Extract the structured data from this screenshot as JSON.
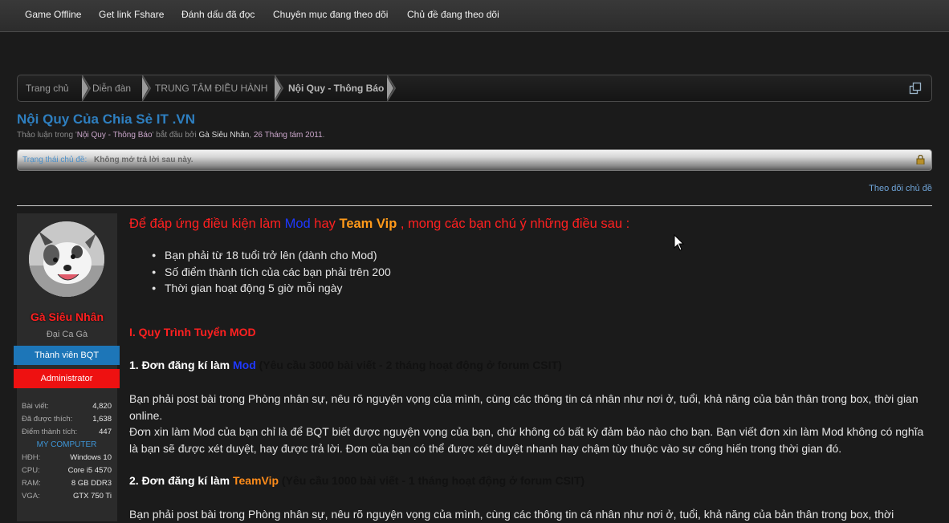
{
  "nav": {
    "items": [
      "Game Offline",
      "Get link Fshare",
      "Đánh dấu đã đọc",
      "Chuyên mục đang theo dõi",
      "Chủ đề đang theo dõi"
    ]
  },
  "breadcrumb": {
    "items": [
      "Trang chủ",
      "Diễn đàn",
      "TRUNG TÂM ĐIỀU HÀNH",
      "Nội Quy - Thông Báo"
    ]
  },
  "thread": {
    "title": "Nội Quy Của Chia Sẻ IT .VN",
    "meta_prefix": "Thảo luận trong '",
    "forum": "Nội Quy - Thông Báo",
    "meta_mid": "' bắt đầu bởi ",
    "author": "Gà Siêu Nhân",
    "date": "26 Tháng tám 2011",
    "status_label": "Trạng thái chủ đề:",
    "status_value": "Không mở trả lời sau này.",
    "follow": "Theo dõi chủ đề"
  },
  "user": {
    "name": "Gà Siêu Nhân",
    "title": "Đại Ca Gà",
    "badge1": "Thành viên BQT",
    "badge2": "Administrator",
    "stats": [
      {
        "k": "Bài viết:",
        "v": "4,820"
      },
      {
        "k": "Đã được thích:",
        "v": "1,638"
      },
      {
        "k": "Điểm thành tích:",
        "v": "447"
      }
    ],
    "mycomputer": "MY COMPUTER",
    "specs": [
      {
        "k": "HĐH:",
        "v": "Windows 10"
      },
      {
        "k": "CPU:",
        "v": "Core i5 4570"
      },
      {
        "k": "RAM:",
        "v": "8 GB DDR3"
      },
      {
        "k": "VGA:",
        "v": "GTX 750 Ti"
      }
    ]
  },
  "post": {
    "headline_a": "Để đáp ứng điều kiện làm ",
    "headline_mod": "Mod",
    "headline_b": " hay ",
    "headline_vip": "Team Vip",
    "headline_c": " , mong các bạn chú ý những điều sau :",
    "bullets": [
      "Bạn phải từ 18 tuổi trở lên (dành cho Mod)",
      "Số điểm thành tích của các bạn phải trên 200",
      "Thời gian hoạt động 5 giờ mỗi ngày"
    ],
    "section1": "I. Quy Trình Tuyển MOD",
    "step1_a": "1. Đơn đăng kí làm ",
    "step1_role": "Mod",
    "step1_req": " (Yêu cầu 3000 bài viết - 2 tháng hoạt động ở forum CSIT)",
    "para1": "Bạn phải post bài trong Phòng nhân sự, nêu rõ nguyện vọng của mình, cùng các thông tin cá nhân như nơi ở, tuổi, khả năng của bản thân trong box, thời gian online.",
    "para2": "Đơn xin làm Mod của bạn chỉ là để BQT biết được nguyện vọng của bạn, chứ không có bất kỳ đảm bảo nào cho bạn. Bạn viết đơn xin làm Mod không có nghĩa là bạn sẽ được xét duyệt, hay được trả lời. Đơn của bạn có thể được xét duyệt nhanh hay chậm tùy thuộc vào sự cống hiến trong thời gian đó.",
    "step2_a": "2. Đơn đăng kí làm ",
    "step2_role": "TeamVip",
    "step2_req": " (Yêu cầu 1000 bài viết - 1 tháng hoạt động ở forum CSIT)",
    "para3": "Bạn phải post bài trong Phòng nhân sự, nêu rõ nguyện vọng của mình, cùng các thông tin cá nhân như nơi ở, tuổi, khả năng của bản thân trong box, thời"
  }
}
